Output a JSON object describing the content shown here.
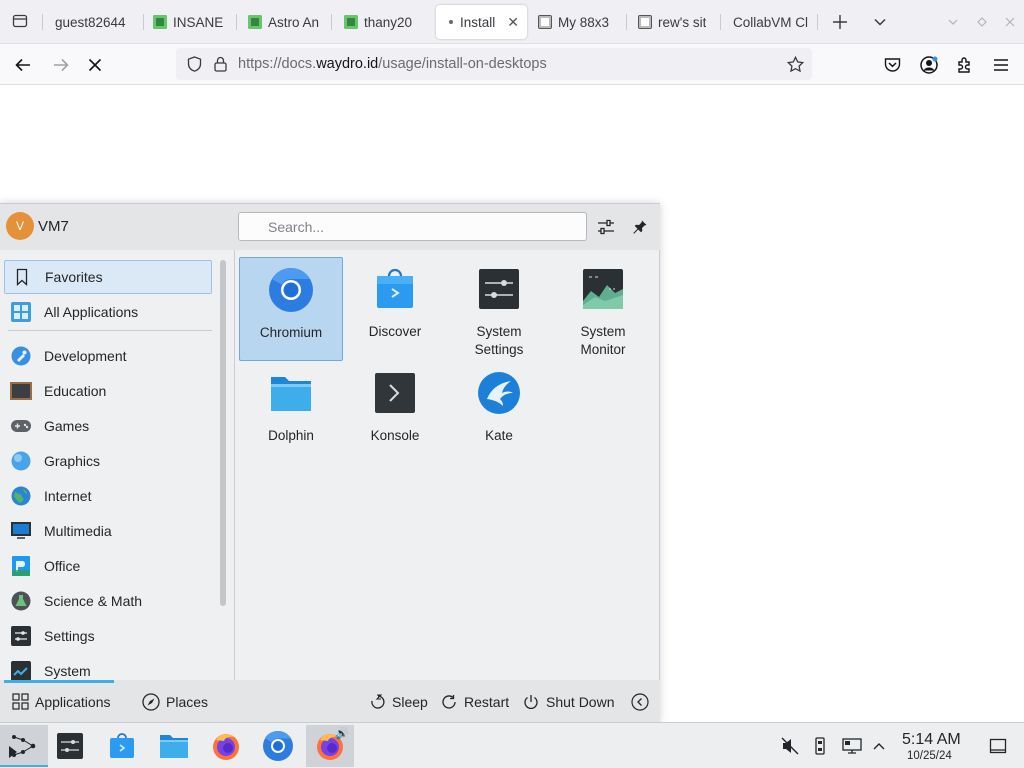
{
  "browser": {
    "tabs": [
      {
        "label": "guest82644",
        "favicon": "none"
      },
      {
        "label": "INSANE",
        "favicon": "green-square-icon"
      },
      {
        "label": "Astro An",
        "favicon": "green-square-icon"
      },
      {
        "label": "thany20",
        "favicon": "green-square-icon"
      },
      {
        "label": "Install",
        "favicon": "loading-dot-icon",
        "active": true
      },
      {
        "label": "My 88x3",
        "favicon": "page-icon"
      },
      {
        "label": "rew's sit",
        "favicon": "page-icon"
      },
      {
        "label": "CollabVM Cl",
        "favicon": "none"
      }
    ],
    "url_prefix": "https://docs.",
    "url_domain": "waydro.id",
    "url_path": "/usage/install-on-desktops"
  },
  "menu": {
    "user": {
      "initial": "V",
      "name": "VM7"
    },
    "search_placeholder": "Search...",
    "sidebar": [
      {
        "label": "Favorites",
        "icon": "bookmark-icon",
        "selected": true
      },
      {
        "label": "All Applications",
        "icon": "grid-icon"
      },
      {
        "label": "Development",
        "icon": "development-icon"
      },
      {
        "label": "Education",
        "icon": "chalkboard-icon"
      },
      {
        "label": "Games",
        "icon": "gamepad-icon"
      },
      {
        "label": "Graphics",
        "icon": "graphics-icon"
      },
      {
        "label": "Internet",
        "icon": "globe-icon"
      },
      {
        "label": "Multimedia",
        "icon": "monitor-icon"
      },
      {
        "label": "Office",
        "icon": "office-icon"
      },
      {
        "label": "Science & Math",
        "icon": "flask-icon"
      },
      {
        "label": "Settings",
        "icon": "settings-icon"
      },
      {
        "label": "System",
        "icon": "system-icon"
      }
    ],
    "apps": [
      {
        "label": "Chromium",
        "icon": "chromium-icon",
        "selected": true
      },
      {
        "label": "Discover",
        "icon": "discover-icon"
      },
      {
        "label": "System\nSettings",
        "line1": "System",
        "line2": "Settings",
        "icon": "system-settings-icon"
      },
      {
        "label": "System\nMonitor",
        "line1": "System",
        "line2": "Monitor",
        "icon": "system-monitor-icon"
      },
      {
        "label": "Dolphin",
        "icon": "folder-icon"
      },
      {
        "label": "Konsole",
        "icon": "terminal-icon"
      },
      {
        "label": "Kate",
        "icon": "kate-icon"
      }
    ],
    "footer": {
      "applications": "Applications",
      "places": "Places",
      "sleep": "Sleep",
      "restart": "Restart",
      "shutdown": "Shut Down"
    }
  },
  "taskbar": {
    "time": "5:14 AM",
    "date": "10/25/24"
  },
  "colors": {
    "accent": "#3daee9",
    "selection": "#b9d6f1",
    "avatar": "#e5913a"
  }
}
